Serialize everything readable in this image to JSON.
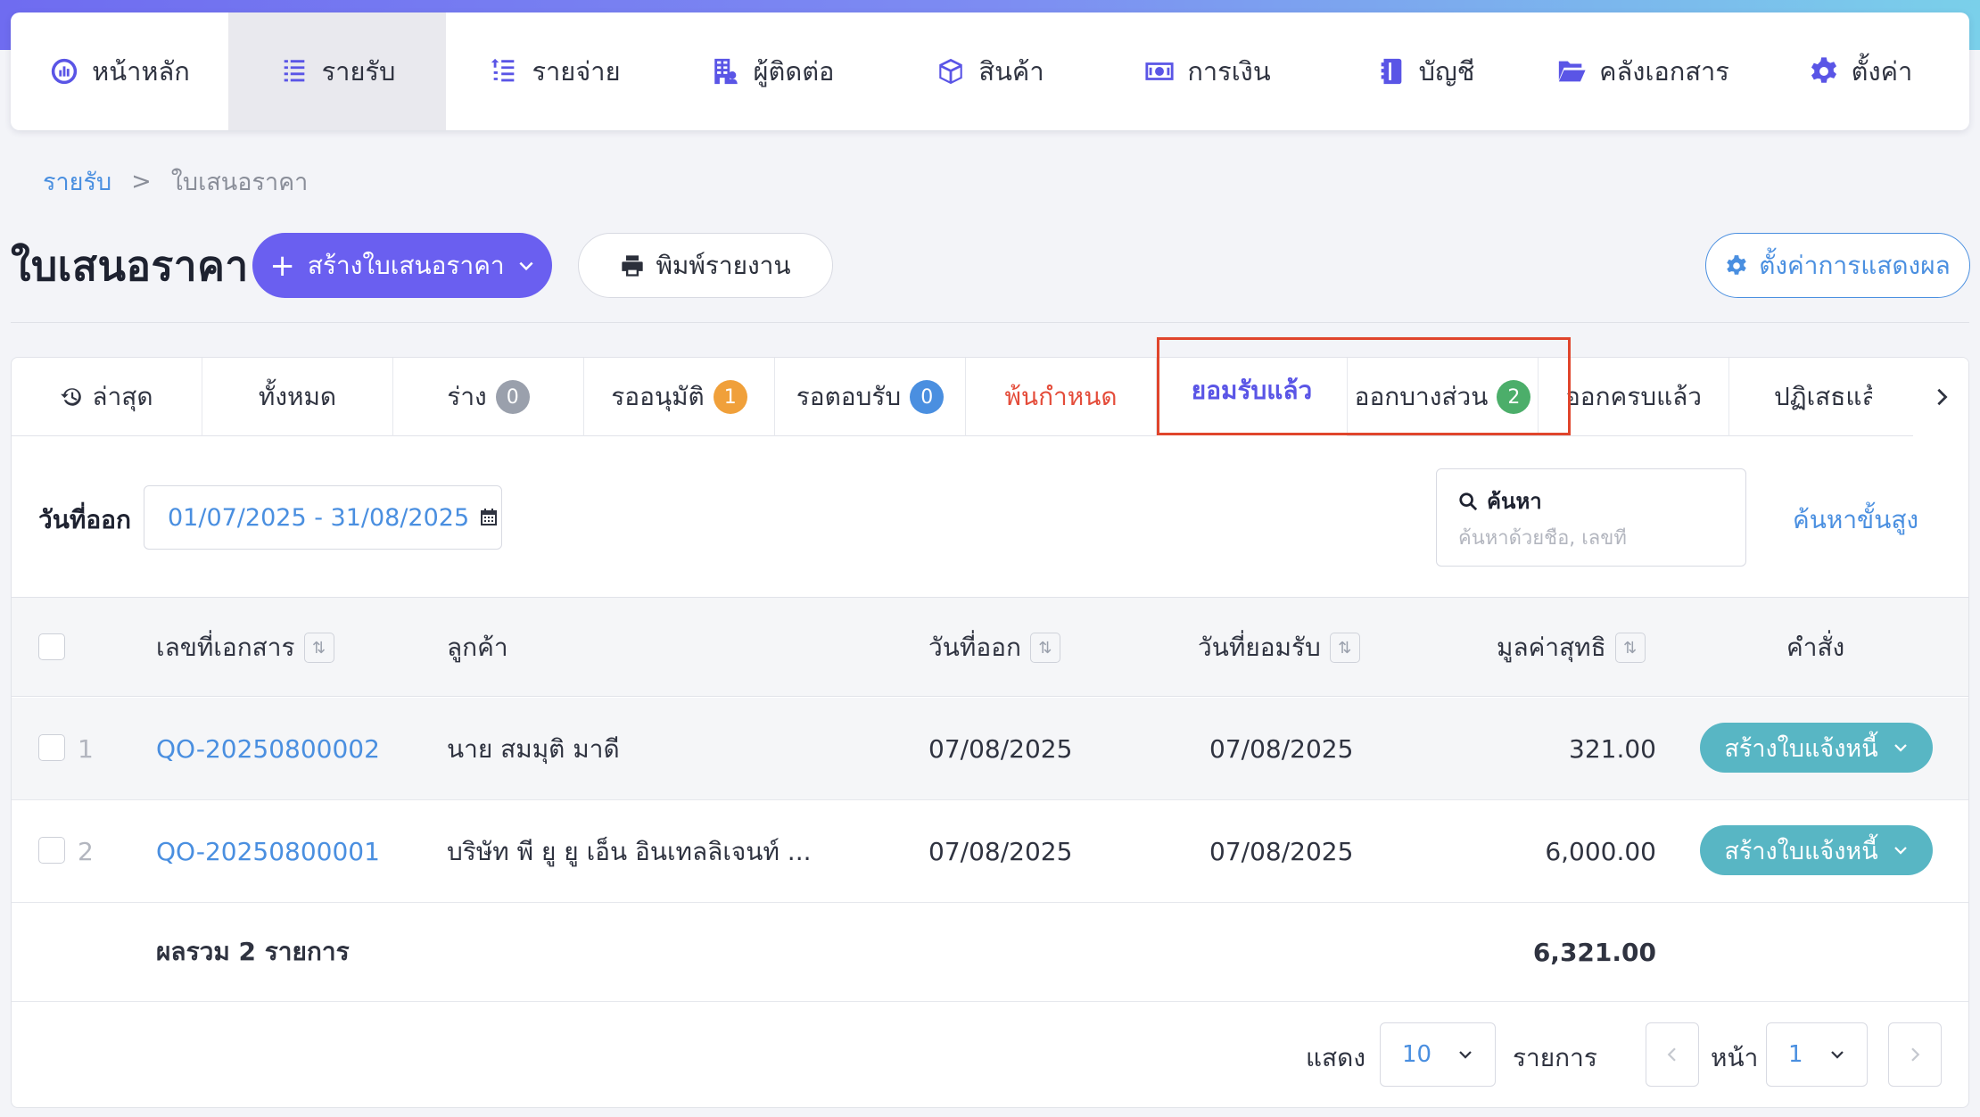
{
  "nav": {
    "items": [
      {
        "label": "หน้าหลัก",
        "icon": "dashboard-icon"
      },
      {
        "label": "รายรับ",
        "icon": "income-list-icon",
        "active": true
      },
      {
        "label": "รายจ่าย",
        "icon": "expense-list-icon"
      },
      {
        "label": "ผู้ติดต่อ",
        "icon": "contacts-building-icon"
      },
      {
        "label": "สินค้า",
        "icon": "product-box-icon"
      },
      {
        "label": "การเงิน",
        "icon": "money-icon"
      },
      {
        "label": "บัญชี",
        "icon": "ledger-book-icon"
      },
      {
        "label": "คลังเอกสาร",
        "icon": "folder-open-icon"
      },
      {
        "label": "ตั้งค่า",
        "icon": "gear-icon"
      }
    ]
  },
  "breadcrumb": {
    "parent": "รายรับ",
    "separator": ">",
    "current": "ใบเสนอราคา"
  },
  "header": {
    "title": "ใบเสนอราคา",
    "create_label": "สร้างใบเสนอราคา",
    "print_label": "พิมพ์รายงาน",
    "display_settings_label": "ตั้งค่าการแสดงผล"
  },
  "tabs": [
    {
      "label": "ล่าสุด"
    },
    {
      "label": "ทั้งหมด"
    },
    {
      "label": "ร่าง",
      "badge": "0"
    },
    {
      "label": "รออนุมัติ",
      "badge": "1"
    },
    {
      "label": "รอตอบรับ",
      "badge": "0"
    },
    {
      "label": "พ้นกำหนด"
    },
    {
      "label": "ยอมรับแล้ว"
    },
    {
      "label": "ออกบางส่วน",
      "badge": "2"
    },
    {
      "label": "ออกครบแล้ว"
    },
    {
      "label": "ปฏิเสธแล้ว"
    }
  ],
  "colors": {
    "primary": "#6a5ff0",
    "link": "#4a8fe0",
    "badge_gray": "#9aa0ac",
    "badge_orange": "#f0a03a",
    "badge_blue": "#4a8fe0",
    "badge_green": "#4cae6a",
    "overdue": "#e44c3a",
    "invoice_button": "#58b6c4",
    "highlight": "#e0452c"
  },
  "filter": {
    "date_label": "วันที่ออก",
    "date_range": "01/07/2025 - 31/08/2025",
    "search_label": "ค้นหา",
    "search_placeholder": "ค้นหาด้วยชื่อ, เลขที่",
    "advanced_search": "ค้นหาขั้นสูง"
  },
  "table": {
    "columns": {
      "doc_no": "เลขที่เอกสาร",
      "customer": "ลูกค้า",
      "issue_date": "วันที่ออก",
      "accept_date": "วันที่ยอมรับ",
      "net_value": "มูลค่าสุทธิ",
      "action": "คำสั่ง"
    },
    "rows": [
      {
        "num": "1",
        "doc_no": "QO-20250800002",
        "customer": "นาย สมมุติ มาดี",
        "issue_date": "07/08/2025",
        "accept_date": "07/08/2025",
        "net_value": "321.00",
        "action": "สร้างใบแจ้งหนี้"
      },
      {
        "num": "2",
        "doc_no": "QO-20250800001",
        "customer": "บริษัท พี ยู ยู เอ็น อินเทลลิเจนท์ ...",
        "issue_date": "07/08/2025",
        "accept_date": "07/08/2025",
        "net_value": "6,000.00",
        "action": "สร้างใบแจ้งหนี้"
      }
    ],
    "total_label": "ผลรวม 2 รายการ",
    "total_value": "6,321.00"
  },
  "pagination": {
    "show_label": "แสดง",
    "per_page": "10",
    "items_label": "รายการ",
    "page_label": "หน้า",
    "page": "1"
  }
}
